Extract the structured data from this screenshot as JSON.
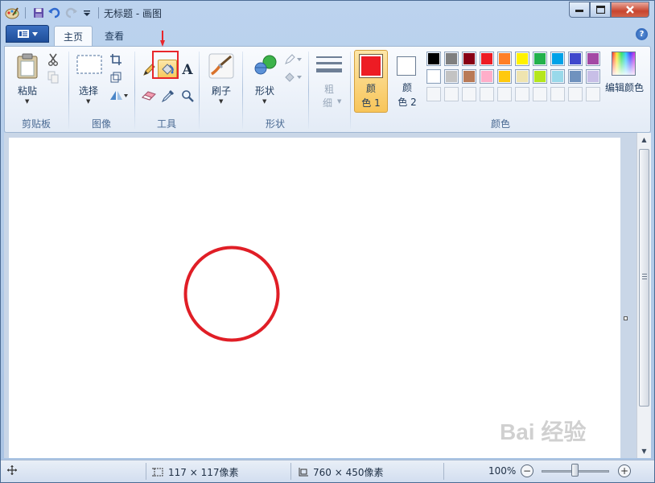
{
  "window": {
    "title": "无标题 - 画图"
  },
  "tabs": [
    {
      "label": "主页",
      "active": true
    },
    {
      "label": "查看",
      "active": false
    }
  ],
  "ribbon": {
    "clipboard": {
      "group_label": "剪贴板",
      "paste_label": "粘贴"
    },
    "image": {
      "group_label": "图像",
      "select_label": "选择"
    },
    "tools": {
      "group_label": "工具"
    },
    "brushes": {
      "label": "刷子"
    },
    "shapes": {
      "group_label": "形状",
      "shapes_label": "形状"
    },
    "size": {
      "label_line1": "粗",
      "label_line2": "细"
    },
    "colors": {
      "group_label": "颜色",
      "color1_label_line1": "颜",
      "color1_label_line2": "色 1",
      "color2_label_line1": "颜",
      "color2_label_line2": "色 2",
      "color1_value": "#ed1c24",
      "color2_value": "#ffffff",
      "edit_label": "编辑颜色",
      "palette_row1": [
        "#000000",
        "#7f7f7f",
        "#880015",
        "#ed1c24",
        "#ff7f27",
        "#fff200",
        "#22b14c",
        "#00a2e8",
        "#3f48cc",
        "#a349a4"
      ],
      "palette_row2": [
        "#ffffff",
        "#c3c3c3",
        "#b97a57",
        "#ffaec9",
        "#ffc90e",
        "#efe4b0",
        "#b5e61d",
        "#99d9ea",
        "#7092be",
        "#c8bfe7"
      ],
      "palette_row3": [
        "",
        "",
        "",
        "",
        "",
        "",
        "",
        "",
        "",
        ""
      ]
    }
  },
  "canvas": {
    "shape": "circle",
    "stroke_color": "#e01e26"
  },
  "status": {
    "selection_size": "117 × 117像素",
    "canvas_size": "760 × 450像素",
    "zoom": "100%",
    "zoom_fraction": 0.5
  },
  "annotation": {
    "highlight_color": "#e8262b"
  },
  "watermark": "Bai 经验"
}
